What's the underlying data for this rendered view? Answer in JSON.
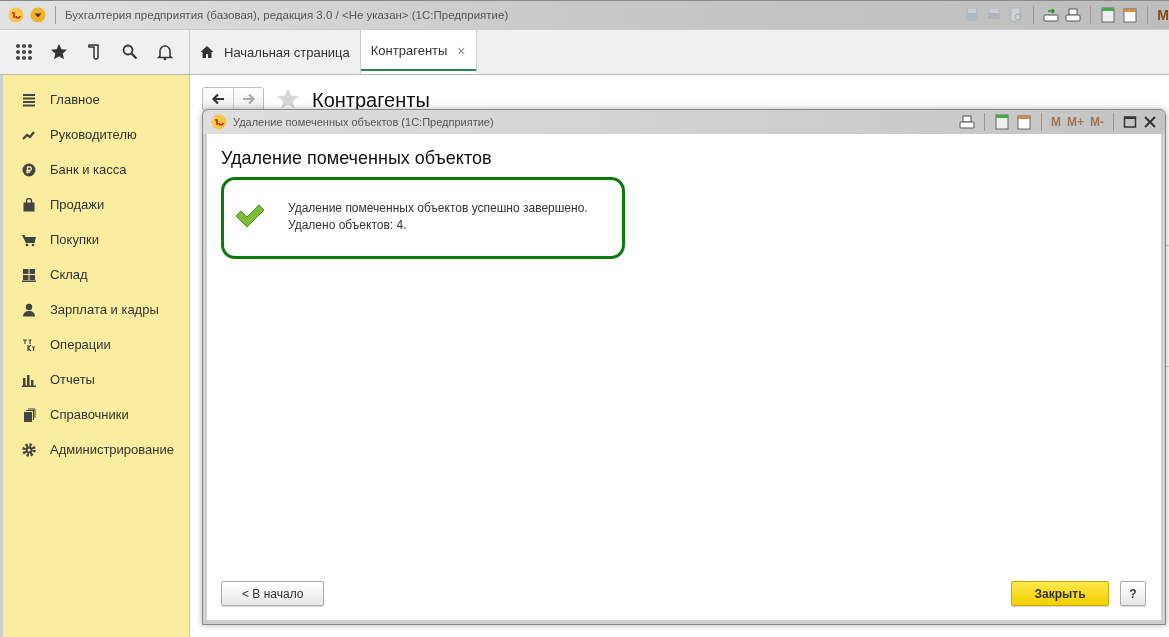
{
  "window": {
    "title": "Бухгалтерия предприятия (базовая), редакция 3.0 / <Не указан>  (1С:Предприятие)",
    "edge_glyph": "M"
  },
  "tabs": [
    {
      "label": "Начальная страница",
      "selected": false,
      "closable": false
    },
    {
      "label": "Контрагенты",
      "selected": true,
      "closable": true,
      "close": "×"
    }
  ],
  "sidebar": {
    "items": [
      {
        "label": "Главное",
        "selected": false
      },
      {
        "label": "Руководителю",
        "selected": false
      },
      {
        "label": "Банк и касса",
        "selected": false
      },
      {
        "label": "Продажи",
        "selected": false
      },
      {
        "label": "Покупки",
        "selected": false
      },
      {
        "label": "Склад",
        "selected": false
      },
      {
        "label": "Зарплата и кадры",
        "selected": false
      },
      {
        "label": "Операции",
        "selected": false
      },
      {
        "label": "Отчеты",
        "selected": false
      },
      {
        "label": "Справочники",
        "selected": false
      },
      {
        "label": "Администрирование",
        "selected": false
      }
    ]
  },
  "page": {
    "title": "Контрагенты",
    "back_disabled": false,
    "forward_disabled": true
  },
  "dialog": {
    "title": "Удаление помеченных объектов  (1С:Предприятие)",
    "memory_keys": [
      {
        "label": "M",
        "disabled": true
      },
      {
        "label": "M+",
        "disabled": true
      },
      {
        "label": "M-",
        "disabled": true
      }
    ],
    "heading": "Удаление помеченных объектов",
    "message": [
      "Удаление помеченных объектов успешно завершено.",
      "Удалено объектов: 4."
    ],
    "buttons": [
      {
        "label": "< В начало",
        "kind": "back"
      },
      {
        "label": "Закрыть",
        "kind": "primary"
      },
      {
        "label": "?",
        "kind": "help"
      }
    ]
  }
}
